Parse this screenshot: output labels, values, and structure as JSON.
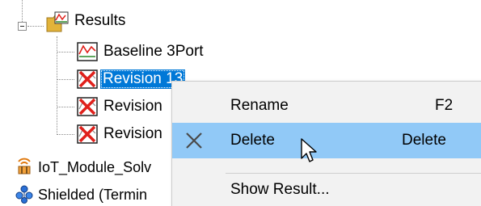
{
  "tree": {
    "results_label": "Results",
    "children": [
      {
        "label": "Baseline 3Port",
        "icon": "chart-icon"
      },
      {
        "label": "Revision 13",
        "icon": "chart-deleted-icon",
        "selected": true
      },
      {
        "label": "Revision",
        "icon": "chart-deleted-icon"
      },
      {
        "label": "Revision",
        "icon": "chart-deleted-icon"
      }
    ],
    "siblings": [
      {
        "label": "IoT_Module_Solv",
        "icon": "antenna-icon"
      },
      {
        "label": "Shielded (Termin",
        "icon": "molecule-icon"
      }
    ]
  },
  "context_menu": {
    "items": [
      {
        "label": "Rename",
        "shortcut": "F2",
        "icon": ""
      },
      {
        "label": "Delete",
        "shortcut": "Delete",
        "icon": "delete-x-icon",
        "highlighted": true
      },
      {
        "label": "Show Result...",
        "shortcut": "",
        "icon": ""
      }
    ]
  },
  "colors": {
    "selection": "#0078d7",
    "menu_hover": "#91c9f7",
    "menu_background": "#f2f2f2",
    "delete_red": "#e0201b"
  }
}
